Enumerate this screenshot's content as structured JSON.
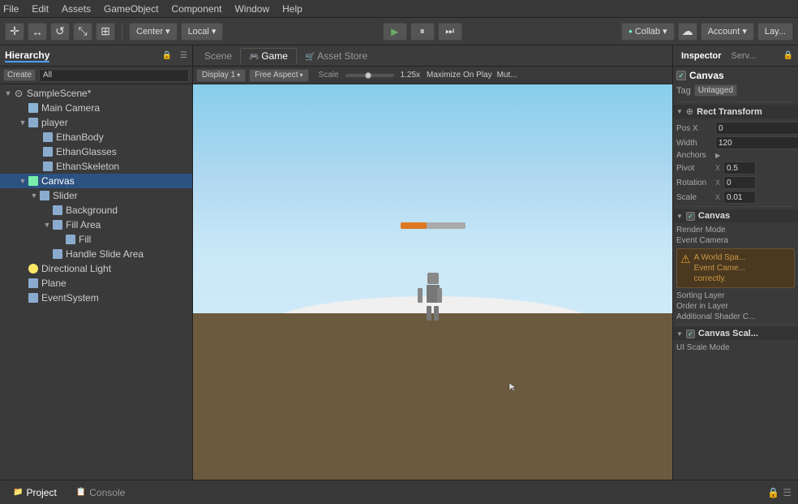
{
  "menu": {
    "items": [
      "File",
      "Edit",
      "Assets",
      "GameObject",
      "Component",
      "Window",
      "Help"
    ]
  },
  "toolbar": {
    "transform_tools": [
      "✛",
      "↔",
      "↺",
      "⤡",
      "⊞"
    ],
    "center_label": "Center",
    "local_label": "Local",
    "play_btn": "▶",
    "pause_btn": "⏸",
    "step_btn": "⏭",
    "collab_label": "Collab ▾",
    "cloud_icon": "☁",
    "account_label": "Account ▾",
    "layout_label": "Lay..."
  },
  "hierarchy": {
    "panel_title": "Hierarchy",
    "create_label": "Create",
    "search_placeholder": "All",
    "items": [
      {
        "id": "samplescene",
        "label": "SampleScene*",
        "indent": 0,
        "has_arrow": true,
        "arrow_open": true,
        "type": "scene"
      },
      {
        "id": "main-camera",
        "label": "Main Camera",
        "indent": 1,
        "has_arrow": false,
        "type": "camera"
      },
      {
        "id": "player",
        "label": "player",
        "indent": 1,
        "has_arrow": true,
        "arrow_open": true,
        "type": "obj"
      },
      {
        "id": "ethanbody",
        "label": "EthanBody",
        "indent": 2,
        "has_arrow": false,
        "type": "obj"
      },
      {
        "id": "ethanglasses",
        "label": "EthanGlasses",
        "indent": 2,
        "has_arrow": false,
        "type": "obj"
      },
      {
        "id": "ethanskeleton",
        "label": "EthanSkeleton",
        "indent": 2,
        "has_arrow": false,
        "type": "obj"
      },
      {
        "id": "canvas",
        "label": "Canvas",
        "indent": 1,
        "has_arrow": true,
        "arrow_open": true,
        "type": "canvas",
        "selected": true
      },
      {
        "id": "slider",
        "label": "Slider",
        "indent": 2,
        "has_arrow": true,
        "arrow_open": true,
        "type": "obj"
      },
      {
        "id": "background",
        "label": "Background",
        "indent": 3,
        "has_arrow": false,
        "type": "obj"
      },
      {
        "id": "fill-area",
        "label": "Fill Area",
        "indent": 3,
        "has_arrow": true,
        "arrow_open": true,
        "type": "obj"
      },
      {
        "id": "fill",
        "label": "Fill",
        "indent": 4,
        "has_arrow": false,
        "type": "obj"
      },
      {
        "id": "handle-slide-area",
        "label": "Handle Slide Area",
        "indent": 3,
        "has_arrow": false,
        "type": "obj"
      },
      {
        "id": "directional-light",
        "label": "Directional Light",
        "indent": 1,
        "has_arrow": false,
        "type": "light"
      },
      {
        "id": "plane",
        "label": "Plane",
        "indent": 1,
        "has_arrow": false,
        "type": "obj"
      },
      {
        "id": "eventsystem",
        "label": "EventSystem",
        "indent": 1,
        "has_arrow": false,
        "type": "obj"
      }
    ]
  },
  "game_view": {
    "tabs": [
      "Scene",
      "Game",
      "Asset Store"
    ],
    "active_tab": "Game",
    "display_label": "Display 1",
    "aspect_label": "Free Aspect",
    "scale_label": "Scale",
    "scale_value": "1.25x",
    "maximize_label": "Maximize On Play",
    "mute_label": "Mut..."
  },
  "inspector": {
    "tabs": [
      "Inspector",
      "Serv..."
    ],
    "active_tab": "Inspector",
    "canvas_name": "Canvas",
    "canvas_checked": true,
    "tag_label": "Tag",
    "tag_value": "Untagged",
    "rect_transform": {
      "section": "Rect Transform",
      "pos_x_label": "Pos X",
      "pos_x_value": "0",
      "width_label": "Width",
      "width_value": "120",
      "anchors_label": "Anchors",
      "pivot_label": "Pivot",
      "pivot_x_label": "X",
      "pivot_x_value": "0.5",
      "rotation_label": "Rotation",
      "rotation_x_label": "X",
      "rotation_x_value": "0",
      "scale_label": "Scale",
      "scale_x_label": "X",
      "scale_x_value": "0.01"
    },
    "canvas_component": {
      "section": "Canvas",
      "checked": true,
      "render_mode_label": "Render Mode",
      "event_camera_label": "Event Camera",
      "warning_text": "A World Spa... Event Came... correctly.",
      "sorting_layer_label": "Sorting Layer",
      "order_in_layer_label": "Order in Layer",
      "additional_shader_label": "Additional Shader C..."
    },
    "canvas_scaler": {
      "section": "Canvas Scal...",
      "checked": true,
      "ui_scale_label": "UI Scale Mode"
    }
  },
  "bottom_bar": {
    "project_label": "Project",
    "console_label": "Console"
  },
  "colors": {
    "accent_blue": "#4a9eff",
    "selected_bg": "#2c5282",
    "toolbar_bg": "#3c3c3c",
    "panel_bg": "#3a3a3a",
    "warning_bg": "#4a3820"
  }
}
